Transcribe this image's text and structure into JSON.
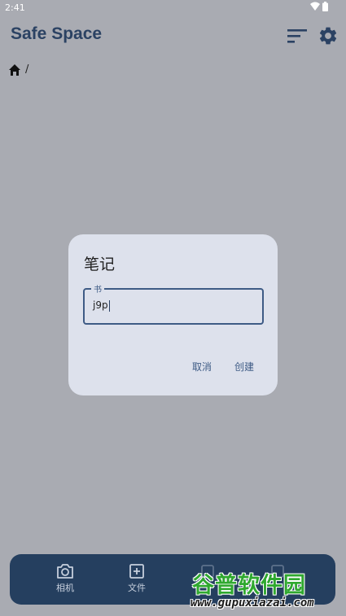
{
  "status_bar": {
    "time": "2:41"
  },
  "header": {
    "title": "Safe Space"
  },
  "breadcrumb": {
    "separator": "/"
  },
  "dialog": {
    "title": "笔记",
    "field_label": "书",
    "field_value": "j9p",
    "cancel_label": "取消",
    "create_label": "创建"
  },
  "bottom_bar": {
    "items": [
      {
        "label": "相机",
        "icon": "camera-icon"
      },
      {
        "label": "文件",
        "icon": "add-box-icon"
      }
    ]
  },
  "watermark": {
    "brand": "谷普软件园",
    "url": "www.gupuxiazai.com"
  },
  "colors": {
    "scrim_background": "#a9abb2",
    "title_color": "#2b4263",
    "dialog_background": "#dde1ec",
    "accent": "#3e5b85",
    "bottom_bar": "#253f5f"
  }
}
